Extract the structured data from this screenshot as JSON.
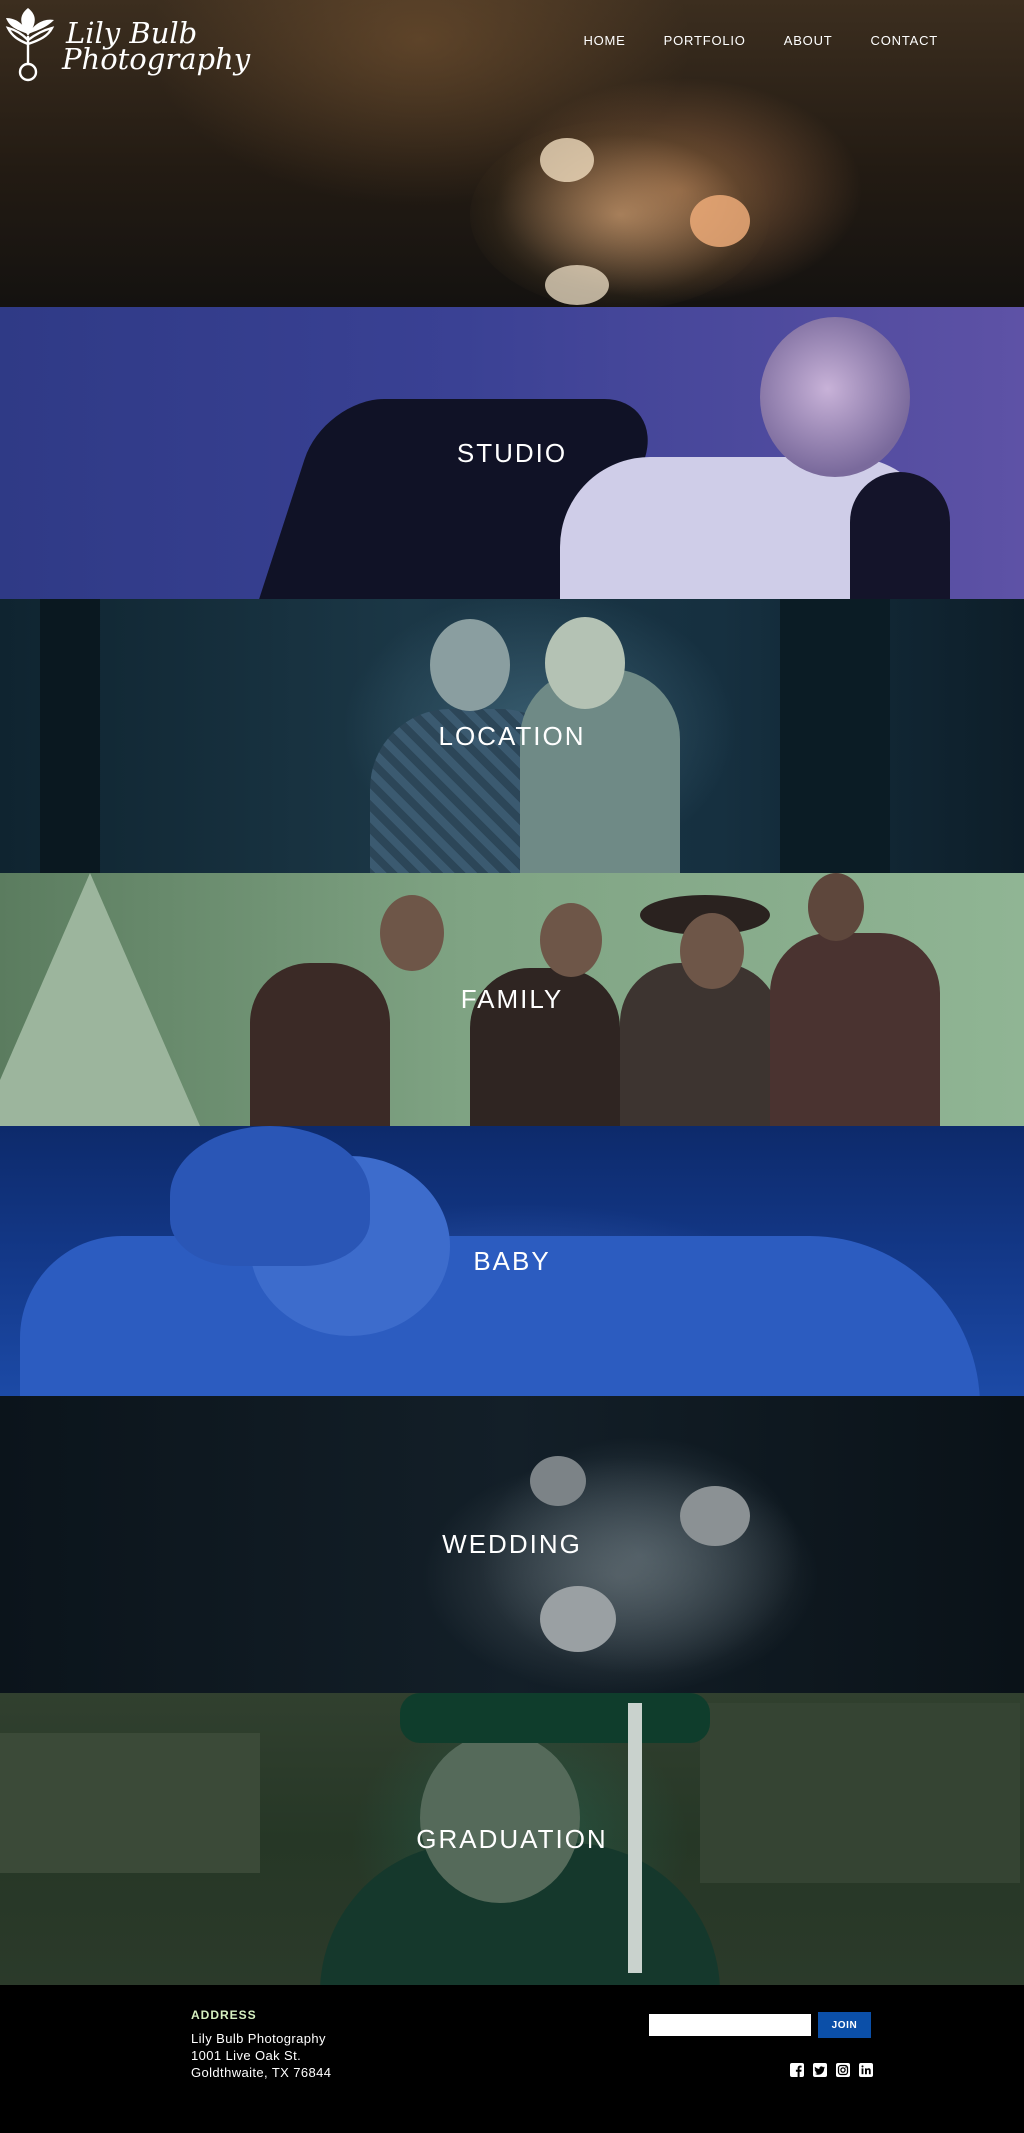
{
  "site": {
    "logo_line1": "Lily Bulb",
    "logo_line2": "Photography"
  },
  "nav": {
    "items": [
      {
        "label": "HOME"
      },
      {
        "label": "PORTFOLIO"
      },
      {
        "label": "ABOUT"
      },
      {
        "label": "CONTACT"
      }
    ]
  },
  "categories": [
    {
      "label": "STUDIO",
      "tint": "#3a4194"
    },
    {
      "label": "LOCATION",
      "tint": "#1b3746"
    },
    {
      "label": "FAMILY",
      "tint": "#7fa383"
    },
    {
      "label": "BABY",
      "tint": "#143a8c"
    },
    {
      "label": "WEDDING",
      "tint": "#131f28"
    },
    {
      "label": "GRADUATION",
      "tint": "#263726"
    }
  ],
  "footer": {
    "address_heading": "ADDRESS",
    "address_lines": [
      "Lily Bulb Photography",
      "1001 Live Oak St.",
      "Goldthwaite, TX 76844"
    ],
    "newsletter": {
      "email_value": "",
      "join_label": "JOIN"
    },
    "social_icons": [
      "facebook-icon",
      "twitter-icon",
      "instagram-icon",
      "linkedin-icon"
    ],
    "accent_color": "#0b4fa8",
    "heading_color": "#d6f0c0"
  }
}
